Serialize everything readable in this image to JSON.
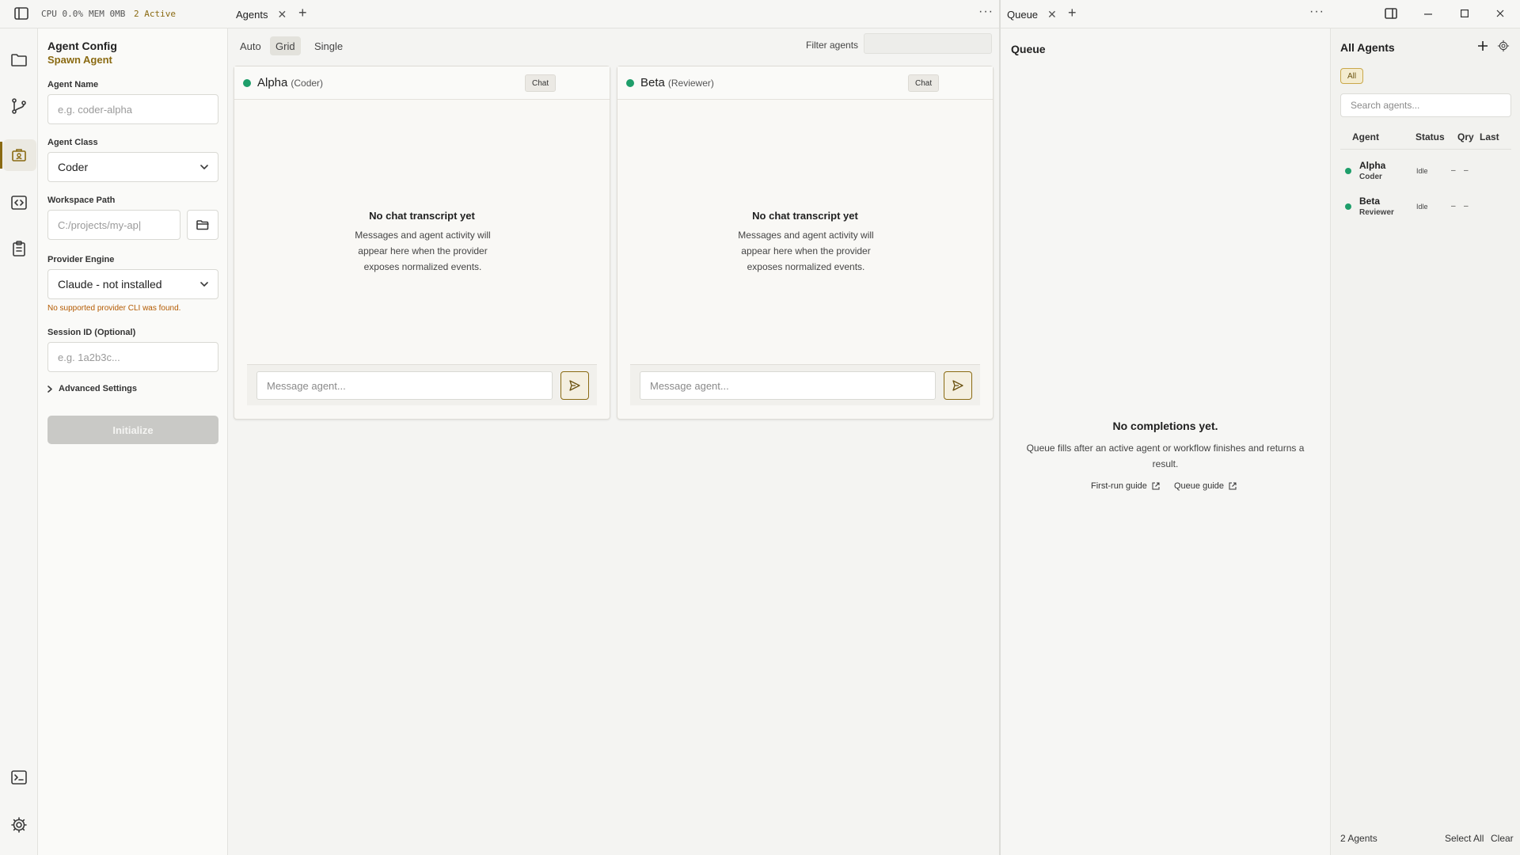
{
  "titlebar": {
    "cpu": "CPU 0.0%",
    "mem": "MEM 0MB",
    "active": "2 Active",
    "tab_agents": "Agents",
    "tab_queue": "Queue",
    "close": "✕",
    "add": "+",
    "more": "···"
  },
  "config": {
    "title": "Agent Config",
    "subtitle": "Spawn Agent",
    "agent_name_label": "Agent Name",
    "agent_name_placeholder": "e.g. coder-alpha",
    "agent_class_label": "Agent Class",
    "agent_class_value": "Coder",
    "workspace_label": "Workspace Path",
    "workspace_placeholder": "C:/projects/my-ap|",
    "provider_label": "Provider Engine",
    "provider_value": "Claude - not installed",
    "provider_warning": "No supported provider CLI was found.",
    "session_label": "Session ID (Optional)",
    "session_placeholder": "e.g. 1a2b3c...",
    "advanced_label": "Advanced Settings",
    "initialize_label": "Initialize"
  },
  "agents_view": {
    "modes": [
      "Auto",
      "Grid",
      "Single"
    ],
    "active_mode": "Grid",
    "filter_label": "Filter agents",
    "cards": [
      {
        "name": "Alpha",
        "role": "(Coder)",
        "status_color": "#1e9e6a",
        "chat_label": "Chat",
        "empty_title": "No chat transcript yet",
        "empty_desc": "Messages and agent activity will appear here when the provider exposes normalized events.",
        "input_placeholder": "Message agent..."
      },
      {
        "name": "Beta",
        "role": "(Reviewer)",
        "status_color": "#1e9e6a",
        "chat_label": "Chat",
        "empty_title": "No chat transcript yet",
        "empty_desc": "Messages and agent activity will appear here when the provider exposes normalized events.",
        "input_placeholder": "Message agent..."
      }
    ]
  },
  "queue": {
    "title": "Queue",
    "empty_title": "No completions yet.",
    "empty_desc": "Queue fills after an active agent or workflow finishes and returns a result.",
    "link_first_run": "First-run guide",
    "link_queue_guide": "Queue guide"
  },
  "all_agents": {
    "title": "All Agents",
    "filter_chip": "All",
    "search_placeholder": "Search agents...",
    "columns": [
      "Agent",
      "Status",
      "Qry",
      "Last"
    ],
    "rows": [
      {
        "name": "Alpha",
        "role": "Coder",
        "status": "Idle",
        "qry": "–",
        "last": "–"
      },
      {
        "name": "Beta",
        "role": "Reviewer",
        "status": "Idle",
        "qry": "–",
        "last": "–"
      }
    ],
    "count_label": "2 Agents",
    "select_all": "Select All",
    "clear": "Clear"
  },
  "colors": {
    "accent": "#8a6a12",
    "status_green": "#1e9e6a",
    "warning": "#b35a00"
  }
}
